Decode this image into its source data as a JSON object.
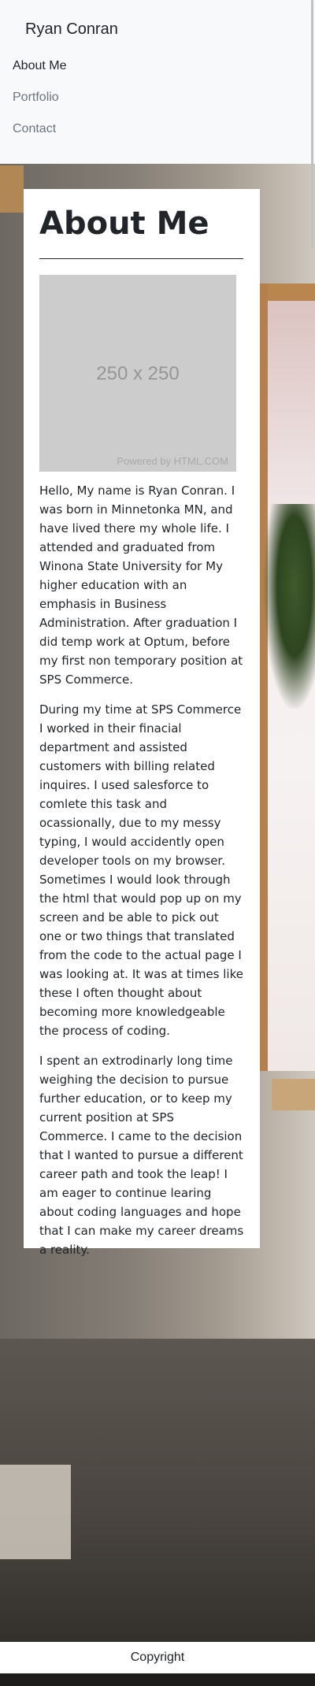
{
  "navbar": {
    "brand": "Ryan Conran",
    "items": [
      {
        "label": "About Me",
        "active": true
      },
      {
        "label": "Portfolio",
        "active": false
      },
      {
        "label": "Contact",
        "active": false
      }
    ]
  },
  "main": {
    "title": "About Me",
    "image": {
      "dimensions_label": "250 x 250",
      "credit": "Powered by HTML.COM"
    },
    "paragraphs": [
      "Hello, My name is Ryan Conran. I was born in Minnetonka MN, and have lived there my whole life. I attended and graduated from Winona State University for My higher education with an emphasis in Business Administration. After graduation I did temp work at Optum, before my first non temporary position at SPS Commerce.",
      "During my time at SPS Commerce I worked in their finacial department and assisted customers with billing related inquires. I used salesforce to comlete this task and ocassionally, due to my messy typing, I would accidently open developer tools on my browser. Sometimes I would look through the html that would pop up on my screen and be able to pick out one or two things that translated from the code to the actual page I was looking at. It was at times like these I often thought about becoming more knowledgeable the process of coding.",
      "I spent an extrodinarly long time weighing the decision to pursue further education, or to keep my current position at SPS Commerce. I came to the decision that I wanted to pursue a different career path and took the leap! I am eager to continue learing about coding languages and hope that I can make my career dreams a reality."
    ]
  },
  "footer": {
    "text": "Copyright"
  },
  "colors": {
    "navbar_bg": "#f8f9fa",
    "text": "#212529",
    "muted": "#6c757d",
    "card_bg": "#ffffff",
    "placeholder_bg": "#cccccc"
  }
}
